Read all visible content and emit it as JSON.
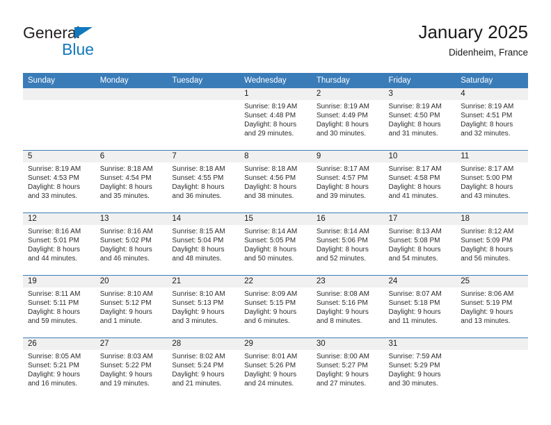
{
  "brand": {
    "name_top": "General",
    "name_bottom": "Blue",
    "triangle_color": "#1278be"
  },
  "header": {
    "title": "January 2025",
    "subtitle": "Didenheim, France",
    "header_bg": "#3a7cb8",
    "daynum_bg": "#f0f0f0"
  },
  "weekday_headers": [
    "Sunday",
    "Monday",
    "Tuesday",
    "Wednesday",
    "Thursday",
    "Friday",
    "Saturday"
  ],
  "labels": {
    "sunrise_prefix": "Sunrise:",
    "sunset_prefix": "Sunset:",
    "daylight_prefix": "Daylight:"
  },
  "weeks": [
    [
      {
        "day": "",
        "empty": true
      },
      {
        "day": "",
        "empty": true
      },
      {
        "day": "",
        "empty": true
      },
      {
        "day": "1",
        "sunrise": "Sunrise: 8:19 AM",
        "sunset": "Sunset: 4:48 PM",
        "daylight_1": "Daylight: 8 hours",
        "daylight_2": "and 29 minutes."
      },
      {
        "day": "2",
        "sunrise": "Sunrise: 8:19 AM",
        "sunset": "Sunset: 4:49 PM",
        "daylight_1": "Daylight: 8 hours",
        "daylight_2": "and 30 minutes."
      },
      {
        "day": "3",
        "sunrise": "Sunrise: 8:19 AM",
        "sunset": "Sunset: 4:50 PM",
        "daylight_1": "Daylight: 8 hours",
        "daylight_2": "and 31 minutes."
      },
      {
        "day": "4",
        "sunrise": "Sunrise: 8:19 AM",
        "sunset": "Sunset: 4:51 PM",
        "daylight_1": "Daylight: 8 hours",
        "daylight_2": "and 32 minutes."
      }
    ],
    [
      {
        "day": "5",
        "sunrise": "Sunrise: 8:19 AM",
        "sunset": "Sunset: 4:53 PM",
        "daylight_1": "Daylight: 8 hours",
        "daylight_2": "and 33 minutes."
      },
      {
        "day": "6",
        "sunrise": "Sunrise: 8:18 AM",
        "sunset": "Sunset: 4:54 PM",
        "daylight_1": "Daylight: 8 hours",
        "daylight_2": "and 35 minutes."
      },
      {
        "day": "7",
        "sunrise": "Sunrise: 8:18 AM",
        "sunset": "Sunset: 4:55 PM",
        "daylight_1": "Daylight: 8 hours",
        "daylight_2": "and 36 minutes."
      },
      {
        "day": "8",
        "sunrise": "Sunrise: 8:18 AM",
        "sunset": "Sunset: 4:56 PM",
        "daylight_1": "Daylight: 8 hours",
        "daylight_2": "and 38 minutes."
      },
      {
        "day": "9",
        "sunrise": "Sunrise: 8:17 AM",
        "sunset": "Sunset: 4:57 PM",
        "daylight_1": "Daylight: 8 hours",
        "daylight_2": "and 39 minutes."
      },
      {
        "day": "10",
        "sunrise": "Sunrise: 8:17 AM",
        "sunset": "Sunset: 4:58 PM",
        "daylight_1": "Daylight: 8 hours",
        "daylight_2": "and 41 minutes."
      },
      {
        "day": "11",
        "sunrise": "Sunrise: 8:17 AM",
        "sunset": "Sunset: 5:00 PM",
        "daylight_1": "Daylight: 8 hours",
        "daylight_2": "and 43 minutes."
      }
    ],
    [
      {
        "day": "12",
        "sunrise": "Sunrise: 8:16 AM",
        "sunset": "Sunset: 5:01 PM",
        "daylight_1": "Daylight: 8 hours",
        "daylight_2": "and 44 minutes."
      },
      {
        "day": "13",
        "sunrise": "Sunrise: 8:16 AM",
        "sunset": "Sunset: 5:02 PM",
        "daylight_1": "Daylight: 8 hours",
        "daylight_2": "and 46 minutes."
      },
      {
        "day": "14",
        "sunrise": "Sunrise: 8:15 AM",
        "sunset": "Sunset: 5:04 PM",
        "daylight_1": "Daylight: 8 hours",
        "daylight_2": "and 48 minutes."
      },
      {
        "day": "15",
        "sunrise": "Sunrise: 8:14 AM",
        "sunset": "Sunset: 5:05 PM",
        "daylight_1": "Daylight: 8 hours",
        "daylight_2": "and 50 minutes."
      },
      {
        "day": "16",
        "sunrise": "Sunrise: 8:14 AM",
        "sunset": "Sunset: 5:06 PM",
        "daylight_1": "Daylight: 8 hours",
        "daylight_2": "and 52 minutes."
      },
      {
        "day": "17",
        "sunrise": "Sunrise: 8:13 AM",
        "sunset": "Sunset: 5:08 PM",
        "daylight_1": "Daylight: 8 hours",
        "daylight_2": "and 54 minutes."
      },
      {
        "day": "18",
        "sunrise": "Sunrise: 8:12 AM",
        "sunset": "Sunset: 5:09 PM",
        "daylight_1": "Daylight: 8 hours",
        "daylight_2": "and 56 minutes."
      }
    ],
    [
      {
        "day": "19",
        "sunrise": "Sunrise: 8:11 AM",
        "sunset": "Sunset: 5:11 PM",
        "daylight_1": "Daylight: 8 hours",
        "daylight_2": "and 59 minutes."
      },
      {
        "day": "20",
        "sunrise": "Sunrise: 8:10 AM",
        "sunset": "Sunset: 5:12 PM",
        "daylight_1": "Daylight: 9 hours",
        "daylight_2": "and 1 minute."
      },
      {
        "day": "21",
        "sunrise": "Sunrise: 8:10 AM",
        "sunset": "Sunset: 5:13 PM",
        "daylight_1": "Daylight: 9 hours",
        "daylight_2": "and 3 minutes."
      },
      {
        "day": "22",
        "sunrise": "Sunrise: 8:09 AM",
        "sunset": "Sunset: 5:15 PM",
        "daylight_1": "Daylight: 9 hours",
        "daylight_2": "and 6 minutes."
      },
      {
        "day": "23",
        "sunrise": "Sunrise: 8:08 AM",
        "sunset": "Sunset: 5:16 PM",
        "daylight_1": "Daylight: 9 hours",
        "daylight_2": "and 8 minutes."
      },
      {
        "day": "24",
        "sunrise": "Sunrise: 8:07 AM",
        "sunset": "Sunset: 5:18 PM",
        "daylight_1": "Daylight: 9 hours",
        "daylight_2": "and 11 minutes."
      },
      {
        "day": "25",
        "sunrise": "Sunrise: 8:06 AM",
        "sunset": "Sunset: 5:19 PM",
        "daylight_1": "Daylight: 9 hours",
        "daylight_2": "and 13 minutes."
      }
    ],
    [
      {
        "day": "26",
        "sunrise": "Sunrise: 8:05 AM",
        "sunset": "Sunset: 5:21 PM",
        "daylight_1": "Daylight: 9 hours",
        "daylight_2": "and 16 minutes."
      },
      {
        "day": "27",
        "sunrise": "Sunrise: 8:03 AM",
        "sunset": "Sunset: 5:22 PM",
        "daylight_1": "Daylight: 9 hours",
        "daylight_2": "and 19 minutes."
      },
      {
        "day": "28",
        "sunrise": "Sunrise: 8:02 AM",
        "sunset": "Sunset: 5:24 PM",
        "daylight_1": "Daylight: 9 hours",
        "daylight_2": "and 21 minutes."
      },
      {
        "day": "29",
        "sunrise": "Sunrise: 8:01 AM",
        "sunset": "Sunset: 5:26 PM",
        "daylight_1": "Daylight: 9 hours",
        "daylight_2": "and 24 minutes."
      },
      {
        "day": "30",
        "sunrise": "Sunrise: 8:00 AM",
        "sunset": "Sunset: 5:27 PM",
        "daylight_1": "Daylight: 9 hours",
        "daylight_2": "and 27 minutes."
      },
      {
        "day": "31",
        "sunrise": "Sunrise: 7:59 AM",
        "sunset": "Sunset: 5:29 PM",
        "daylight_1": "Daylight: 9 hours",
        "daylight_2": "and 30 minutes."
      },
      {
        "day": "",
        "empty": true
      }
    ]
  ]
}
